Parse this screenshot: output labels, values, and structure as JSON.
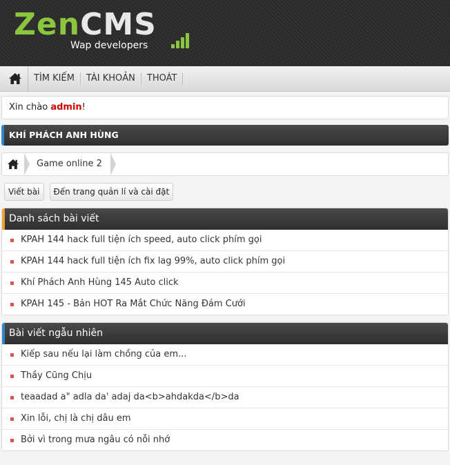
{
  "header": {
    "logo_zen": "Zen",
    "logo_cms": "CMS",
    "logo_tagline": "Wap developers"
  },
  "nav": {
    "home_icon": "home-icon",
    "items": [
      "TÌM KIẾM",
      "TÀI KHOẢN",
      "THOÁT"
    ]
  },
  "greeting": {
    "prefix": "Xin chào ",
    "user": "admin",
    "suffix": "!"
  },
  "page_title": "KHÍ PHÁCH ANH HÙNG",
  "breadcrumb": {
    "home_icon": "home-icon",
    "items": [
      "Game online 2"
    ]
  },
  "actions": {
    "write_post": "Viết bài",
    "manage": "Đến trang quản lí và cài đặt"
  },
  "post_list": {
    "title": "Danh sách bài viết",
    "items": [
      "KPAH 144 hack full tiện ích speed, auto click phím gọi",
      "KPAH 144 hack full tiện ích fix lag 99%, auto click phím gọi",
      "Khí Phách Anh Hùng 145 Auto click",
      "KPAH 145 - Bản HOT Ra Mắt Chức Năng Đám Cưới"
    ]
  },
  "random_list": {
    "title": "Bài viết ngẫu nhiên",
    "items": [
      "Kiếp sau nếu lại làm chồng của em...",
      "Thầy Cũng Chịu",
      "teaadad a\" adla da' adaj da<b>ahdakda</b>da",
      "Xin lỗi, chị là chị dâu em",
      "Bởi vì trong mưa ngâu có nỗi nhớ"
    ]
  },
  "colors": {
    "accent_green": "#8cc63f",
    "accent_blue": "#2f87c8",
    "accent_orange": "#f0a030",
    "user_red": "#cc0000",
    "bullet_red": "#d9534f"
  }
}
